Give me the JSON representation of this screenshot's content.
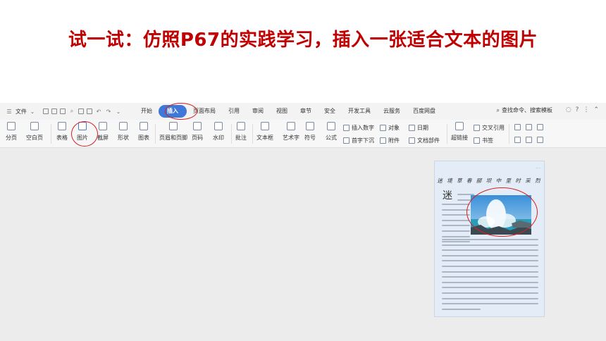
{
  "slide": {
    "title": "试一试：仿照P67的实践学习，插入一张适合文本的图片"
  },
  "menubar": {
    "file_label": "文件",
    "tabs": [
      "开始",
      "插入",
      "页面布局",
      "引用",
      "审阅",
      "视图",
      "章节",
      "安全",
      "开发工具",
      "云服务",
      "百度网盘"
    ],
    "active_tab": "插入",
    "search_label": "查找命令、搜索模板"
  },
  "ribbon": {
    "buttons": {
      "page_break": "分页",
      "blank_page": "空白页",
      "table": "表格",
      "picture": "图片",
      "screenshot": "截屏",
      "shape": "形状",
      "chart": "图表",
      "header_footer": "页眉和页脚",
      "page_number": "页码",
      "watermark": "水印",
      "comment": "批注",
      "textbox": "文本框",
      "wordart": "艺术字",
      "symbol": "符号",
      "formula": "公式",
      "hyperlink": "超链接",
      "bookmark": "书签"
    },
    "small": {
      "insert_number": "插入数字",
      "object": "对象",
      "date": "日期",
      "drop_cap": "首字下沉",
      "attachment": "附件",
      "doc_parts": "文档部件",
      "cross_ref": "交叉引用"
    }
  },
  "document": {
    "corner_note": "······",
    "heading": "迷 境 草 春 郦 坝 中 里 时 采 烈",
    "drop_char": "迷"
  }
}
